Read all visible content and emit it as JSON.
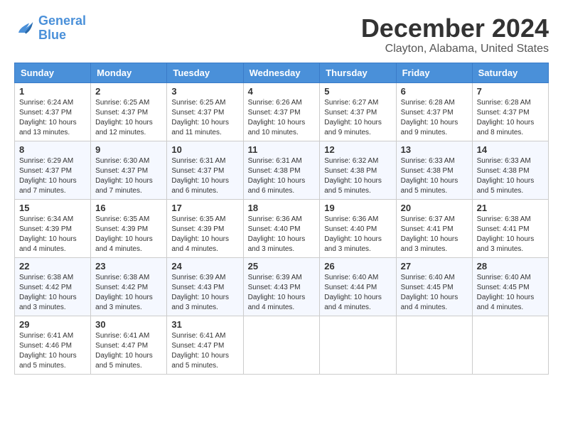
{
  "header": {
    "logo_line1": "General",
    "logo_line2": "Blue",
    "month_title": "December 2024",
    "location": "Clayton, Alabama, United States"
  },
  "weekdays": [
    "Sunday",
    "Monday",
    "Tuesday",
    "Wednesday",
    "Thursday",
    "Friday",
    "Saturday"
  ],
  "weeks": [
    [
      {
        "day": "1",
        "sunrise": "6:24 AM",
        "sunset": "4:37 PM",
        "daylight": "10 hours and 13 minutes."
      },
      {
        "day": "2",
        "sunrise": "6:25 AM",
        "sunset": "4:37 PM",
        "daylight": "10 hours and 12 minutes."
      },
      {
        "day": "3",
        "sunrise": "6:25 AM",
        "sunset": "4:37 PM",
        "daylight": "10 hours and 11 minutes."
      },
      {
        "day": "4",
        "sunrise": "6:26 AM",
        "sunset": "4:37 PM",
        "daylight": "10 hours and 10 minutes."
      },
      {
        "day": "5",
        "sunrise": "6:27 AM",
        "sunset": "4:37 PM",
        "daylight": "10 hours and 9 minutes."
      },
      {
        "day": "6",
        "sunrise": "6:28 AM",
        "sunset": "4:37 PM",
        "daylight": "10 hours and 9 minutes."
      },
      {
        "day": "7",
        "sunrise": "6:28 AM",
        "sunset": "4:37 PM",
        "daylight": "10 hours and 8 minutes."
      }
    ],
    [
      {
        "day": "8",
        "sunrise": "6:29 AM",
        "sunset": "4:37 PM",
        "daylight": "10 hours and 7 minutes."
      },
      {
        "day": "9",
        "sunrise": "6:30 AM",
        "sunset": "4:37 PM",
        "daylight": "10 hours and 7 minutes."
      },
      {
        "day": "10",
        "sunrise": "6:31 AM",
        "sunset": "4:37 PM",
        "daylight": "10 hours and 6 minutes."
      },
      {
        "day": "11",
        "sunrise": "6:31 AM",
        "sunset": "4:38 PM",
        "daylight": "10 hours and 6 minutes."
      },
      {
        "day": "12",
        "sunrise": "6:32 AM",
        "sunset": "4:38 PM",
        "daylight": "10 hours and 5 minutes."
      },
      {
        "day": "13",
        "sunrise": "6:33 AM",
        "sunset": "4:38 PM",
        "daylight": "10 hours and 5 minutes."
      },
      {
        "day": "14",
        "sunrise": "6:33 AM",
        "sunset": "4:38 PM",
        "daylight": "10 hours and 5 minutes."
      }
    ],
    [
      {
        "day": "15",
        "sunrise": "6:34 AM",
        "sunset": "4:39 PM",
        "daylight": "10 hours and 4 minutes."
      },
      {
        "day": "16",
        "sunrise": "6:35 AM",
        "sunset": "4:39 PM",
        "daylight": "10 hours and 4 minutes."
      },
      {
        "day": "17",
        "sunrise": "6:35 AM",
        "sunset": "4:39 PM",
        "daylight": "10 hours and 4 minutes."
      },
      {
        "day": "18",
        "sunrise": "6:36 AM",
        "sunset": "4:40 PM",
        "daylight": "10 hours and 3 minutes."
      },
      {
        "day": "19",
        "sunrise": "6:36 AM",
        "sunset": "4:40 PM",
        "daylight": "10 hours and 3 minutes."
      },
      {
        "day": "20",
        "sunrise": "6:37 AM",
        "sunset": "4:41 PM",
        "daylight": "10 hours and 3 minutes."
      },
      {
        "day": "21",
        "sunrise": "6:38 AM",
        "sunset": "4:41 PM",
        "daylight": "10 hours and 3 minutes."
      }
    ],
    [
      {
        "day": "22",
        "sunrise": "6:38 AM",
        "sunset": "4:42 PM",
        "daylight": "10 hours and 3 minutes."
      },
      {
        "day": "23",
        "sunrise": "6:38 AM",
        "sunset": "4:42 PM",
        "daylight": "10 hours and 3 minutes."
      },
      {
        "day": "24",
        "sunrise": "6:39 AM",
        "sunset": "4:43 PM",
        "daylight": "10 hours and 3 minutes."
      },
      {
        "day": "25",
        "sunrise": "6:39 AM",
        "sunset": "4:43 PM",
        "daylight": "10 hours and 4 minutes."
      },
      {
        "day": "26",
        "sunrise": "6:40 AM",
        "sunset": "4:44 PM",
        "daylight": "10 hours and 4 minutes."
      },
      {
        "day": "27",
        "sunrise": "6:40 AM",
        "sunset": "4:45 PM",
        "daylight": "10 hours and 4 minutes."
      },
      {
        "day": "28",
        "sunrise": "6:40 AM",
        "sunset": "4:45 PM",
        "daylight": "10 hours and 4 minutes."
      }
    ],
    [
      {
        "day": "29",
        "sunrise": "6:41 AM",
        "sunset": "4:46 PM",
        "daylight": "10 hours and 5 minutes."
      },
      {
        "day": "30",
        "sunrise": "6:41 AM",
        "sunset": "4:47 PM",
        "daylight": "10 hours and 5 minutes."
      },
      {
        "day": "31",
        "sunrise": "6:41 AM",
        "sunset": "4:47 PM",
        "daylight": "10 hours and 5 minutes."
      },
      null,
      null,
      null,
      null
    ]
  ]
}
